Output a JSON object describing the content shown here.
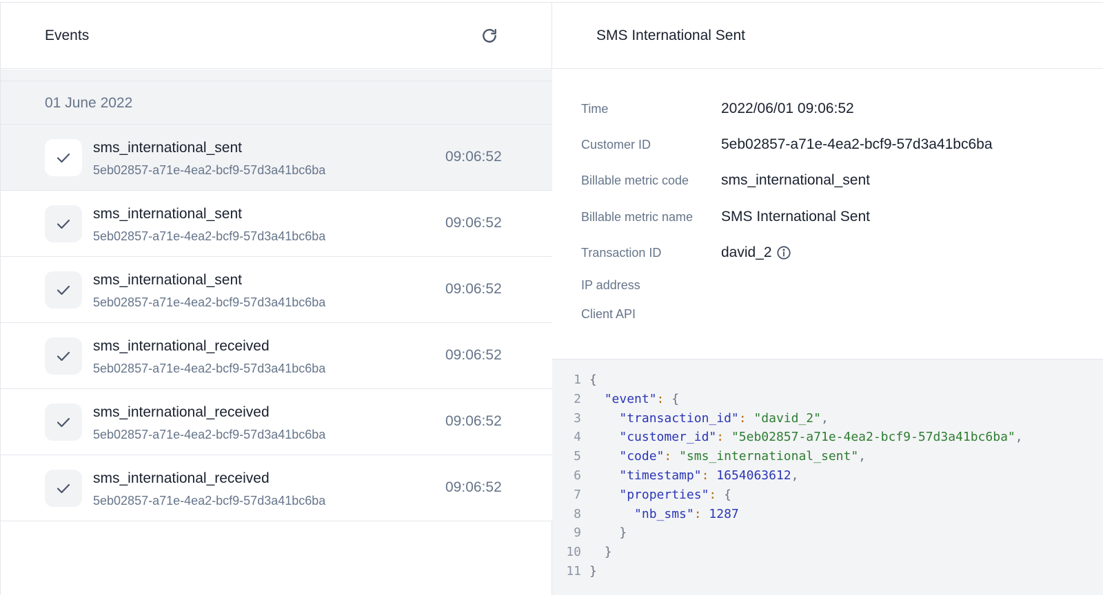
{
  "events_panel": {
    "title": "Events",
    "refresh_icon": "refresh-icon",
    "date_group": "01 June 2022",
    "items": [
      {
        "name": "sms_international_sent",
        "customer_id": "5eb02857-a71e-4ea2-bcf9-57d3a41bc6ba",
        "time": "09:06:52",
        "selected": true
      },
      {
        "name": "sms_international_sent",
        "customer_id": "5eb02857-a71e-4ea2-bcf9-57d3a41bc6ba",
        "time": "09:06:52",
        "selected": false
      },
      {
        "name": "sms_international_sent",
        "customer_id": "5eb02857-a71e-4ea2-bcf9-57d3a41bc6ba",
        "time": "09:06:52",
        "selected": false
      },
      {
        "name": "sms_international_received",
        "customer_id": "5eb02857-a71e-4ea2-bcf9-57d3a41bc6ba",
        "time": "09:06:52",
        "selected": false
      },
      {
        "name": "sms_international_received",
        "customer_id": "5eb02857-a71e-4ea2-bcf9-57d3a41bc6ba",
        "time": "09:06:52",
        "selected": false
      },
      {
        "name": "sms_international_received",
        "customer_id": "5eb02857-a71e-4ea2-bcf9-57d3a41bc6ba",
        "time": "09:06:52",
        "selected": false
      }
    ]
  },
  "detail_panel": {
    "title": "SMS International Sent",
    "properties": {
      "time_label": "Time",
      "time_value": "2022/06/01 09:06:52",
      "customer_id_label": "Customer ID",
      "customer_id_value": "5eb02857-a71e-4ea2-bcf9-57d3a41bc6ba",
      "metric_code_label": "Billable metric code",
      "metric_code_value": "sms_international_sent",
      "metric_name_label": "Billable metric name",
      "metric_name_value": "SMS International Sent",
      "transaction_id_label": "Transaction ID",
      "transaction_id_value": "david_2",
      "ip_address_label": "IP address",
      "client_api_label": "Client API"
    },
    "payload": {
      "line_numbers": [
        "1",
        "2",
        "3",
        "4",
        "5",
        "6",
        "7",
        "8",
        "9",
        "10",
        "11"
      ],
      "event_key": "\"event\"",
      "transaction_id_key": "\"transaction_id\"",
      "transaction_id_val": "\"david_2\"",
      "customer_id_key": "\"customer_id\"",
      "customer_id_val": "\"5eb02857-a71e-4ea2-bcf9-57d3a41bc6ba\"",
      "code_key": "\"code\"",
      "code_val": "\"sms_international_sent\"",
      "timestamp_key": "\"timestamp\"",
      "timestamp_val": "1654063612",
      "properties_key": "\"properties\"",
      "nb_sms_key": "\"nb_sms\"",
      "nb_sms_val": "1287"
    }
  },
  "colors": {
    "text_primary": "#19212e",
    "text_secondary": "#66758a",
    "selected_bg": "#f2f3f5",
    "border": "#e3e6eb",
    "json_key": "#2a36b5",
    "json_string": "#2e7d32"
  }
}
